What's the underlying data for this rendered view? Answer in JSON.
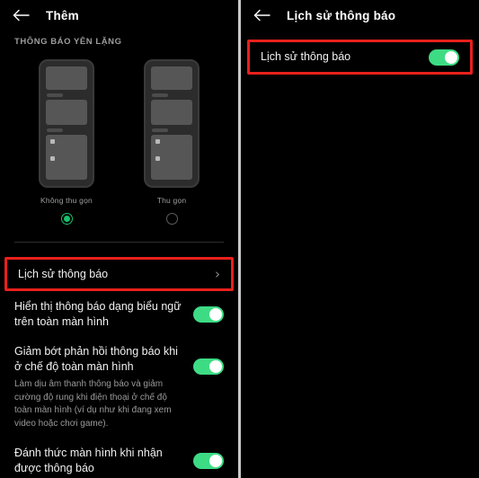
{
  "left_panel": {
    "appbar": {
      "back_icon": "back-arrow-icon",
      "title": "Thêm"
    },
    "section_header": "THÔNG BÁO YÊN LẶNG",
    "mockups": [
      {
        "label": "Không thu gọn",
        "selected": true
      },
      {
        "label": "Thu gọn",
        "selected": false
      }
    ],
    "rows": {
      "history": {
        "title": "Lịch sử thông báo",
        "chevron": "›",
        "highlighted": true
      },
      "banner": {
        "title": "Hiển thị thông báo dạng biểu ngữ trên toàn màn hình",
        "toggle_on": true
      },
      "reduce": {
        "title": "Giảm bớt phản hồi thông báo khi ở chế độ toàn màn hình",
        "subtitle": "Làm dịu âm thanh thông báo và giảm cường độ rung khi điện thoại ở chế độ toàn màn hình (ví dụ như khi đang xem video hoặc chơi game).",
        "toggle_on": true
      },
      "wake": {
        "title": "Đánh thức màn hình khi nhận được thông báo",
        "toggle_on": true
      }
    }
  },
  "right_panel": {
    "appbar": {
      "back_icon": "back-arrow-icon",
      "title": "Lịch sử thông báo"
    },
    "rows": {
      "history": {
        "title": "Lịch sử thông báo",
        "toggle_on": true,
        "highlighted": true
      }
    }
  },
  "colors": {
    "background": "#000000",
    "toggle_on": "#3ddc84",
    "radio_selected": "#17c26b",
    "highlight_border": "#e8201c",
    "divider": "#c9c9c9",
    "primary_text": "#f1f1f1",
    "secondary_text": "#9a9a9a"
  }
}
